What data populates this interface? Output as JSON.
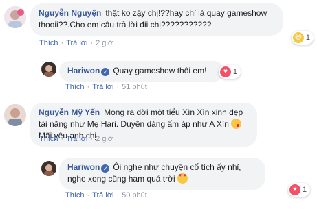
{
  "comments": [
    {
      "author": "Nguyễn Nguyện",
      "text": "thật ko zậy chị!??hay chỉ là quay gameshow thooii??.Cho em câu trả lời đii chị???????????",
      "actions": {
        "like": "Thích",
        "reply": "Trả lời",
        "time": "2 giờ"
      },
      "reaction": {
        "icon": "haha-icon",
        "count": "1"
      }
    },
    {
      "author": "Hariwon",
      "verified": true,
      "text": "Quay gameshow thôi em!",
      "actions": {
        "like": "Thích",
        "reply": "Trả lời",
        "time": "51 phút"
      },
      "reaction": {
        "icon": "love-icon",
        "count": "1"
      }
    },
    {
      "author": "Nguyễn Mỹ Yến",
      "text_1": "Mong ra đời một tiểu Xìn Xìn xinh đẹp tài năng như Mẹ Hari. Duyên dáng ấm áp như A Xìn",
      "text_2": "Mãi yêu anh chị",
      "actions": {
        "like": "Thích",
        "reply": "Trả lời",
        "time": "2 giờ"
      }
    },
    {
      "author": "Hariwon",
      "verified": true,
      "text": "Ôi nghe như chuyện cổ tích ấy nhỉ, nghe xong cũng ham quá trời",
      "actions": {
        "like": "Thích",
        "reply": "Trả lời",
        "time": "50 phút"
      },
      "reaction": {
        "icon": "love-icon",
        "count": "1"
      }
    }
  ],
  "colors": {
    "name": "#365899",
    "link": "#4267b2",
    "meta": "#90949c",
    "bubble": "#f2f3f5"
  }
}
